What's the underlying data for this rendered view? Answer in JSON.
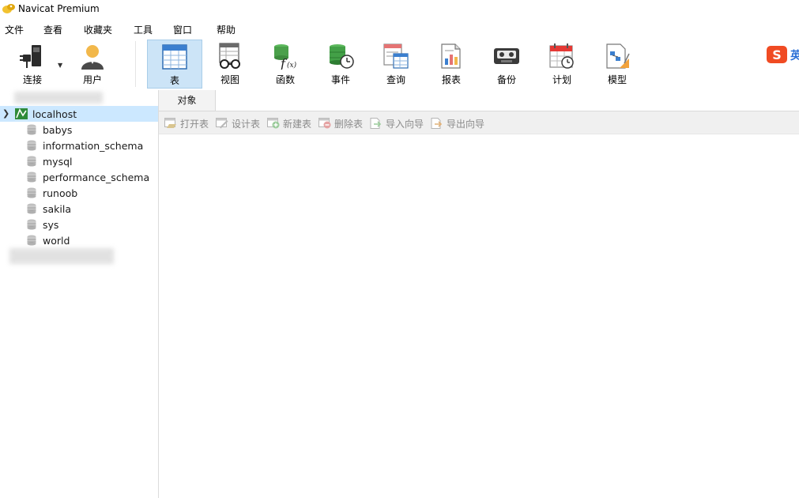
{
  "window": {
    "title": "Navicat Premium"
  },
  "menu": {
    "file": "文件",
    "view": "查看",
    "favorites": "收藏夹",
    "tools": "工具",
    "window": "窗口",
    "help": "帮助"
  },
  "toolbar": {
    "connection": "连接",
    "user": "用户",
    "table": "表",
    "view": "视图",
    "function": "函数",
    "event": "事件",
    "query": "查询",
    "report": "报表",
    "backup": "备份",
    "schedule": "计划",
    "model": "模型",
    "active_tool": "table"
  },
  "sidebar": {
    "connection": {
      "label": "localhost",
      "expanded": true
    },
    "databases": [
      {
        "label": "babys"
      },
      {
        "label": "information_schema"
      },
      {
        "label": "mysql"
      },
      {
        "label": "performance_schema"
      },
      {
        "label": "runoob"
      },
      {
        "label": "sakila"
      },
      {
        "label": "sys"
      },
      {
        "label": "world"
      }
    ]
  },
  "tabs": {
    "objects": "对象"
  },
  "object_toolbar": {
    "open_table": "打开表",
    "design_table": "设计表",
    "new_table": "新建表",
    "delete_table": "删除表",
    "import_wizard": "导入向导",
    "export_wizard": "导出向导"
  },
  "icons": {
    "app_logo": "navicat-logo-icon",
    "sogou": "sogou-ime-icon"
  },
  "colors": {
    "selection": "#cce8ff",
    "active_tool": "#cce4f7",
    "toolbar_disabled_text": "#8a8a8a"
  }
}
